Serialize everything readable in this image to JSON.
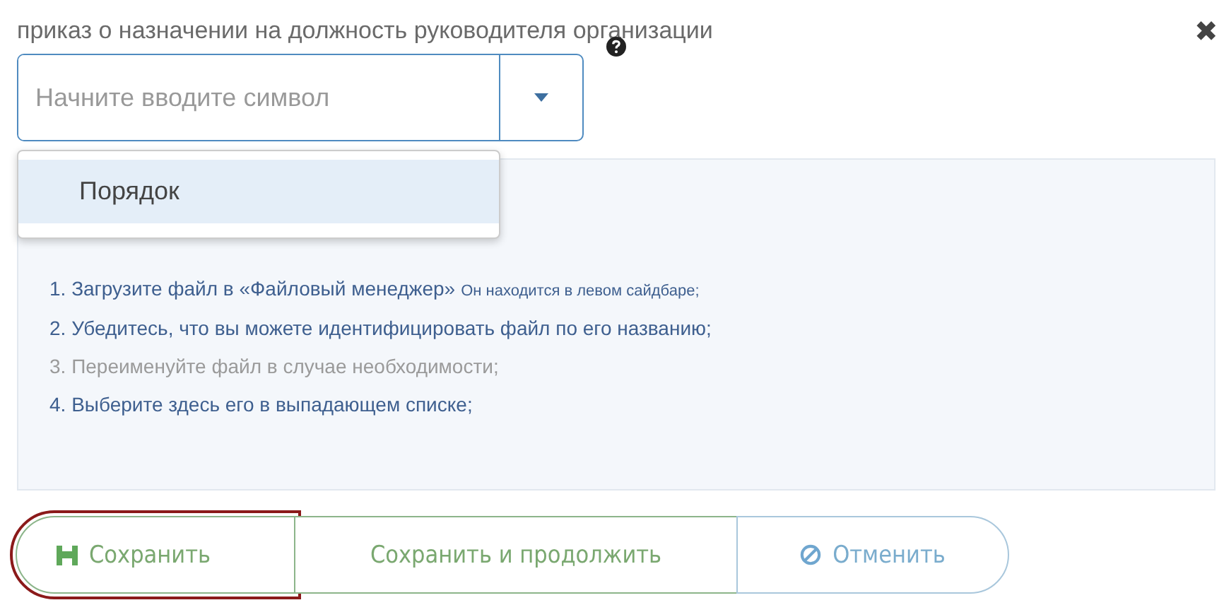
{
  "label": "приказ о назначении на должность руководителя организации",
  "close": "✖",
  "combo": {
    "placeholder": "Начните вводите символ",
    "expanded": true,
    "options": [
      {
        "label": "Порядок",
        "selected": true
      }
    ]
  },
  "steps": [
    {
      "number": "1.",
      "text": "Загрузите файл в «Файловый менеджер»",
      "note": "Он находится в левом сайдбаре;",
      "muted": false
    },
    {
      "number": "2.",
      "text": "Убедитесь, что вы можете идентифицировать файл по его названию;",
      "muted": false
    },
    {
      "number": "3.",
      "text": "Переименуйте файл в случае необходимости;",
      "muted": true
    },
    {
      "number": "4.",
      "text": "Выберите здесь его в выпадающем списке;",
      "muted": false
    }
  ],
  "buttons": [
    {
      "label": "Сохранить",
      "kind": "save",
      "focused": true
    },
    {
      "label": "Сохранить и продолжить",
      "kind": "continue",
      "focused": false
    },
    {
      "label": "Отменить",
      "kind": "cancel",
      "focused": false
    }
  ]
}
